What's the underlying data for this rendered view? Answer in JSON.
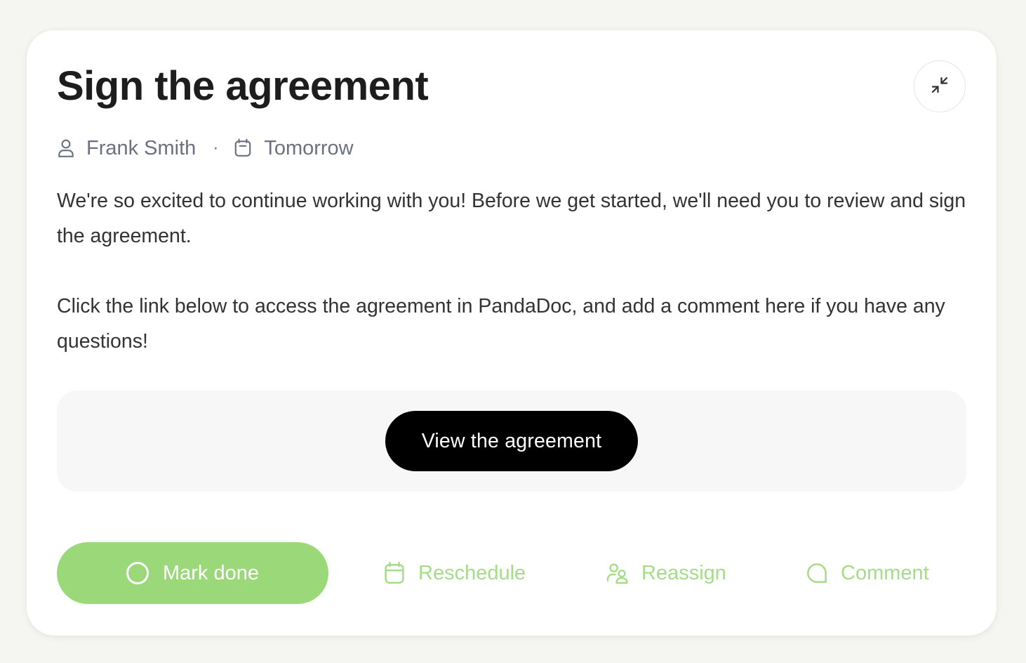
{
  "task": {
    "title": "Sign the agreement",
    "assignee": "Frank Smith",
    "separator": "·",
    "due": "Tomorrow",
    "description": [
      "We're so excited to continue working with you! Before we get started, we'll need you to review and sign the agreement.",
      "Click the link below to access the agreement in PandaDoc, and add a comment here if you have any questions!"
    ]
  },
  "cta": {
    "label": "View the agreement"
  },
  "actions": {
    "mark_done": "Mark done",
    "reschedule": "Reschedule",
    "reassign": "Reassign",
    "comment": "Comment"
  },
  "icons": {
    "collapse": "collapse-icon",
    "assignee": "user-icon",
    "due": "calendar-icon",
    "mark_done": "circle-icon",
    "reschedule": "calendar-icon",
    "reassign": "users-icon",
    "comment": "comment-icon"
  },
  "colors": {
    "accent_green": "#9ad87a",
    "link_green": "#a5dc8a",
    "cta_black": "#000000",
    "meta_gray": "#6b7180"
  }
}
